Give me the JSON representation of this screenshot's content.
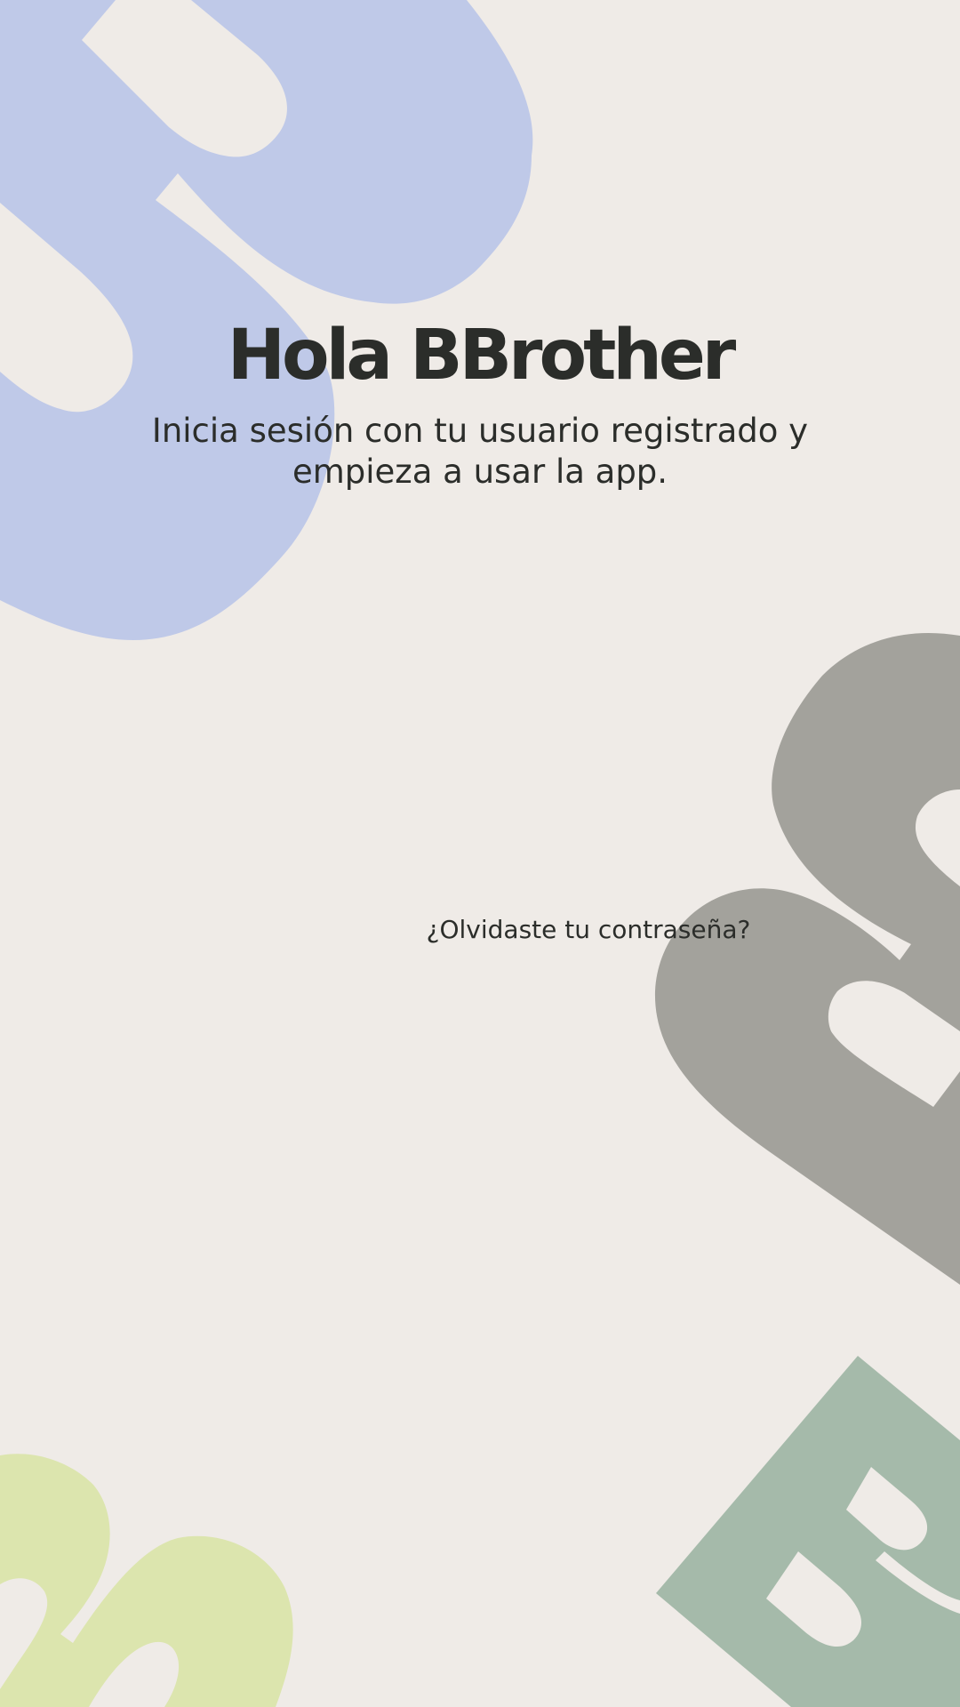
{
  "login": {
    "title": "Hola BBrother",
    "subtitle": "Inicia sesión con tu usuario registrado y empieza a usar la app.",
    "forgot_password": "¿Olvidaste tu contraseña?"
  },
  "colors": {
    "background": "#EFEBE7",
    "text": "#2B2D2A",
    "shape_blue": "#BFC9E8",
    "shape_gray": "#A3A29C",
    "shape_green": "#A5BAAA",
    "shape_lime": "#DCE5AE"
  }
}
